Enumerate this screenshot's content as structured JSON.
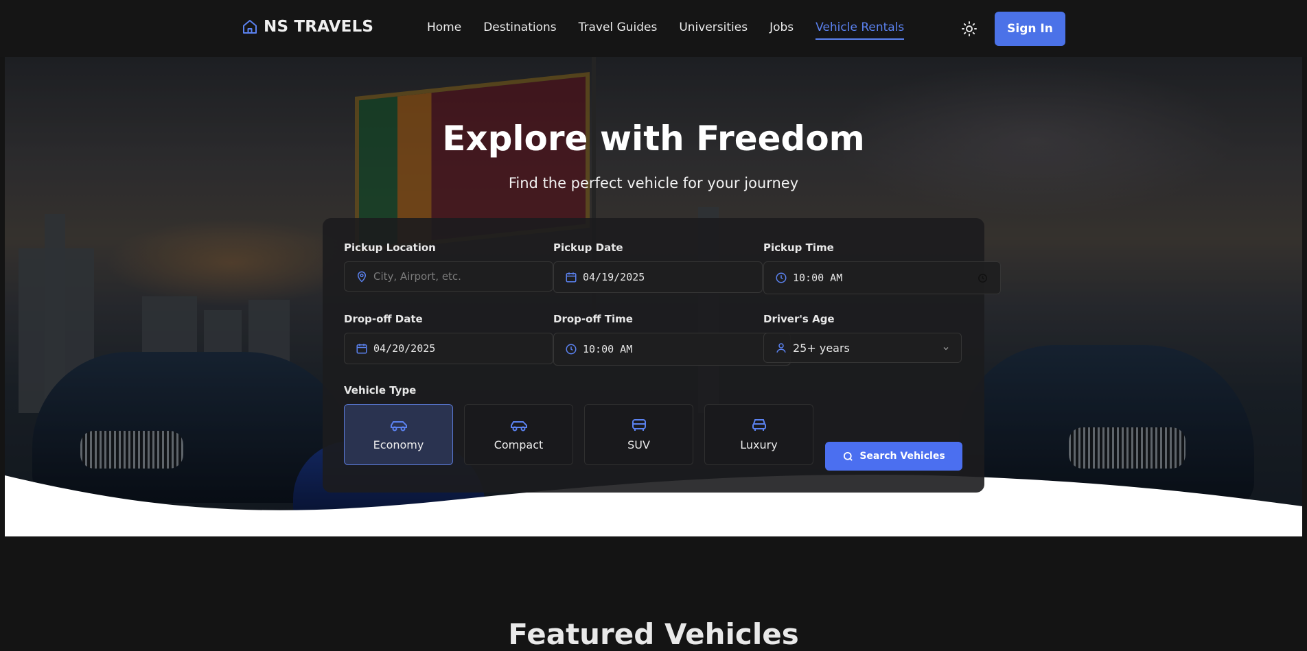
{
  "brand": {
    "name": "NS TRAVELS"
  },
  "nav": {
    "links": [
      "Home",
      "Destinations",
      "Travel Guides",
      "Universities",
      "Jobs",
      "Vehicle Rentals"
    ],
    "active": "Vehicle Rentals",
    "sign_in": "Sign In"
  },
  "hero": {
    "title": "Explore with Freedom",
    "subtitle": "Find the perfect vehicle for your journey"
  },
  "form": {
    "pickup_location": {
      "label": "Pickup Location",
      "placeholder": "City, Airport, etc.",
      "value": ""
    },
    "pickup_date": {
      "label": "Pickup Date",
      "value": "04/19/2025"
    },
    "pickup_time": {
      "label": "Pickup Time",
      "value": "10:00 AM"
    },
    "dropoff_date": {
      "label": "Drop-off Date",
      "value": "04/20/2025"
    },
    "dropoff_time": {
      "label": "Drop-off Time",
      "value": "10:00 AM"
    },
    "driver_age": {
      "label": "Driver's Age",
      "value": "25+ years"
    },
    "vehicle_type": {
      "label": "Vehicle Type",
      "options": [
        "Economy",
        "Compact",
        "SUV",
        "Luxury"
      ],
      "selected": "Economy"
    },
    "search_button": "Search Vehicles"
  },
  "featured": {
    "title": "Featured Vehicles"
  },
  "colors": {
    "accent": "#4b72e8",
    "active_link": "#5b82f0",
    "background": "#141414"
  },
  "icons": [
    "home-icon",
    "sun-icon",
    "map-pin-icon",
    "calendar-icon",
    "clock-icon",
    "user-icon",
    "chevron-down-icon",
    "car-icon",
    "suv-icon",
    "search-icon"
  ]
}
